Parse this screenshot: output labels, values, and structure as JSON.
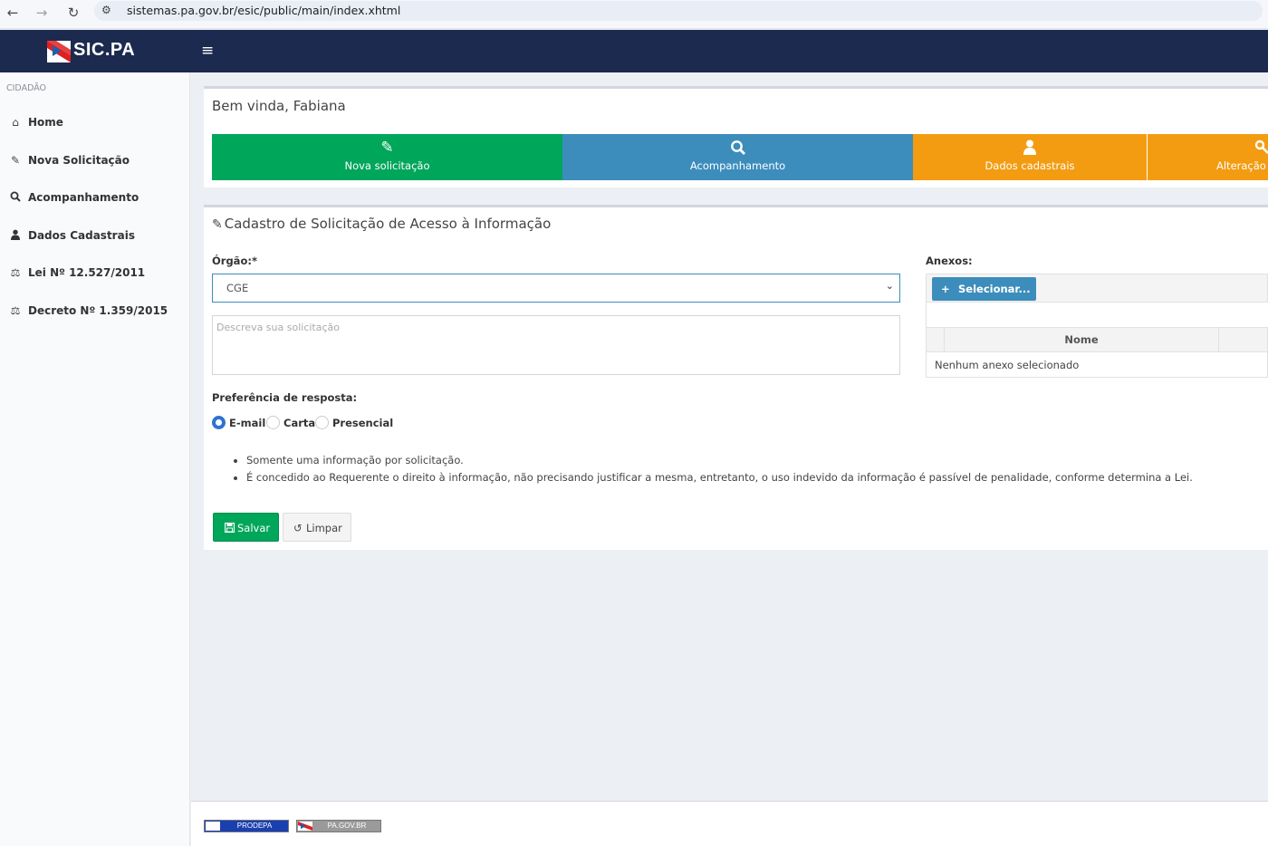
{
  "browser": {
    "url": "sistemas.pa.gov.br/esic/public/main/index.xhtml",
    "back_icon": "arrow-left-icon",
    "forward_icon": "arrow-right-icon",
    "reload_icon": "reload-icon"
  },
  "header": {
    "logo_text": "SIC.PA",
    "menu_icon": "hamburger-icon",
    "background": "#1b2a4e"
  },
  "sidebar": {
    "section_label": "CIDADÃO",
    "items": [
      {
        "label": "Home",
        "icon": "home-icon"
      },
      {
        "label": "Nova Solicitação",
        "icon": "edit-icon"
      },
      {
        "label": "Acompanhamento",
        "icon": "search-icon"
      },
      {
        "label": "Dados Cadastrais",
        "icon": "user-icon"
      },
      {
        "label": "Lei Nº 12.527/2011",
        "icon": "balance-scale-icon"
      },
      {
        "label": "Decreto Nº 1.359/2015",
        "icon": "balance-scale-icon"
      }
    ]
  },
  "welcome": {
    "title": "Bem vinda, Fabiana",
    "tiles": [
      {
        "label": "Nova solicitação",
        "icon": "edit-icon",
        "color": "#00a65a"
      },
      {
        "label": "Acompanhamento",
        "icon": "search-icon",
        "color": "#3c8dbc"
      },
      {
        "label": "Dados cadastrais",
        "icon": "user-icon",
        "color": "#f39c12"
      },
      {
        "label": "Alteração",
        "icon": "key-icon",
        "color": "#f39c12"
      }
    ]
  },
  "form": {
    "title": "Cadastro de Solicitação de Acesso à Informação",
    "orgao_label": "Órgão:*",
    "orgao_value": "CGE",
    "description_placeholder": "Descreva sua solicitação",
    "preference_label": "Preferência de resposta:",
    "preference_options": [
      "E-mail",
      "Carta",
      "Presencial"
    ],
    "preference_selected": "E-mail",
    "notes": [
      "Somente uma informação por solicitação.",
      "É concedido ao Requerente o direito à informação, não precisando justificar a mesma, entretanto, o uso indevido da informação é passível de penalidade, conforme determina a Lei."
    ],
    "save_label": "Salvar",
    "clear_label": "Limpar"
  },
  "attachments": {
    "label": "Anexos:",
    "select_label": "Selecionar...",
    "column_name": "Nome",
    "empty_text": "Nenhum anexo selecionado"
  },
  "footer": {
    "badges": [
      "PRODEPA",
      "PA.GOV.BR"
    ]
  }
}
